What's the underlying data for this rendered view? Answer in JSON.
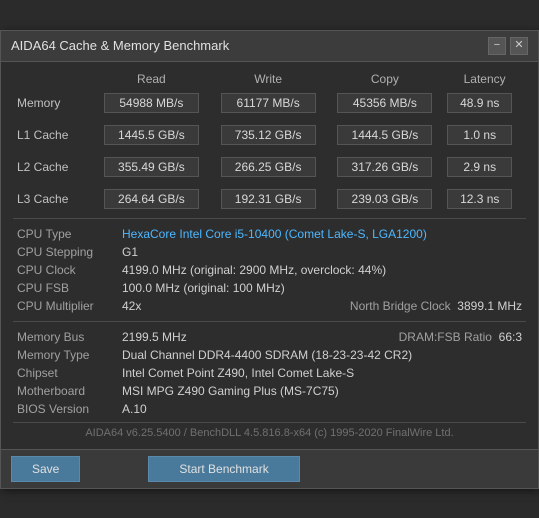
{
  "window": {
    "title": "AIDA64 Cache & Memory Benchmark",
    "minimize_label": "−",
    "close_label": "✕"
  },
  "table": {
    "headers": {
      "label": "",
      "read": "Read",
      "write": "Write",
      "copy": "Copy",
      "latency": "Latency"
    },
    "rows": [
      {
        "label": "Memory",
        "read": "54988 MB/s",
        "write": "61177 MB/s",
        "copy": "45356 MB/s",
        "latency": "48.9 ns"
      },
      {
        "label": "L1 Cache",
        "read": "1445.5 GB/s",
        "write": "735.12 GB/s",
        "copy": "1444.5 GB/s",
        "latency": "1.0 ns"
      },
      {
        "label": "L2 Cache",
        "read": "355.49 GB/s",
        "write": "266.25 GB/s",
        "copy": "317.26 GB/s",
        "latency": "2.9 ns"
      },
      {
        "label": "L3 Cache",
        "read": "264.64 GB/s",
        "write": "192.31 GB/s",
        "copy": "239.03 GB/s",
        "latency": "12.3 ns"
      }
    ]
  },
  "info": {
    "cpu_type_label": "CPU Type",
    "cpu_type_value": "HexaCore Intel Core i5-10400  (Comet Lake-S, LGA1200)",
    "cpu_stepping_label": "CPU Stepping",
    "cpu_stepping_value": "G1",
    "cpu_clock_label": "CPU Clock",
    "cpu_clock_value": "4199.0 MHz  (original: 2900 MHz, overclock: 44%)",
    "cpu_fsb_label": "CPU FSB",
    "cpu_fsb_value": "100.0 MHz  (original: 100 MHz)",
    "cpu_multiplier_label": "CPU Multiplier",
    "cpu_multiplier_value": "42x",
    "north_bridge_label": "North Bridge Clock",
    "north_bridge_value": "3899.1 MHz",
    "memory_bus_label": "Memory Bus",
    "memory_bus_value": "2199.5 MHz",
    "dram_fsb_label": "DRAM:FSB Ratio",
    "dram_fsb_value": "66:3",
    "memory_type_label": "Memory Type",
    "memory_type_value": "Dual Channel DDR4-4400 SDRAM  (18-23-23-42 CR2)",
    "chipset_label": "Chipset",
    "chipset_value": "Intel Comet Point Z490, Intel Comet Lake-S",
    "motherboard_label": "Motherboard",
    "motherboard_value": "MSI MPG Z490 Gaming Plus (MS-7C75)",
    "bios_label": "BIOS Version",
    "bios_value": "A.10"
  },
  "footer": {
    "text": "AIDA64 v6.25.5400 / BenchDLL 4.5.816.8-x64  (c) 1995-2020 FinalWire Ltd."
  },
  "buttons": {
    "save": "Save",
    "start": "Start Benchmark"
  }
}
